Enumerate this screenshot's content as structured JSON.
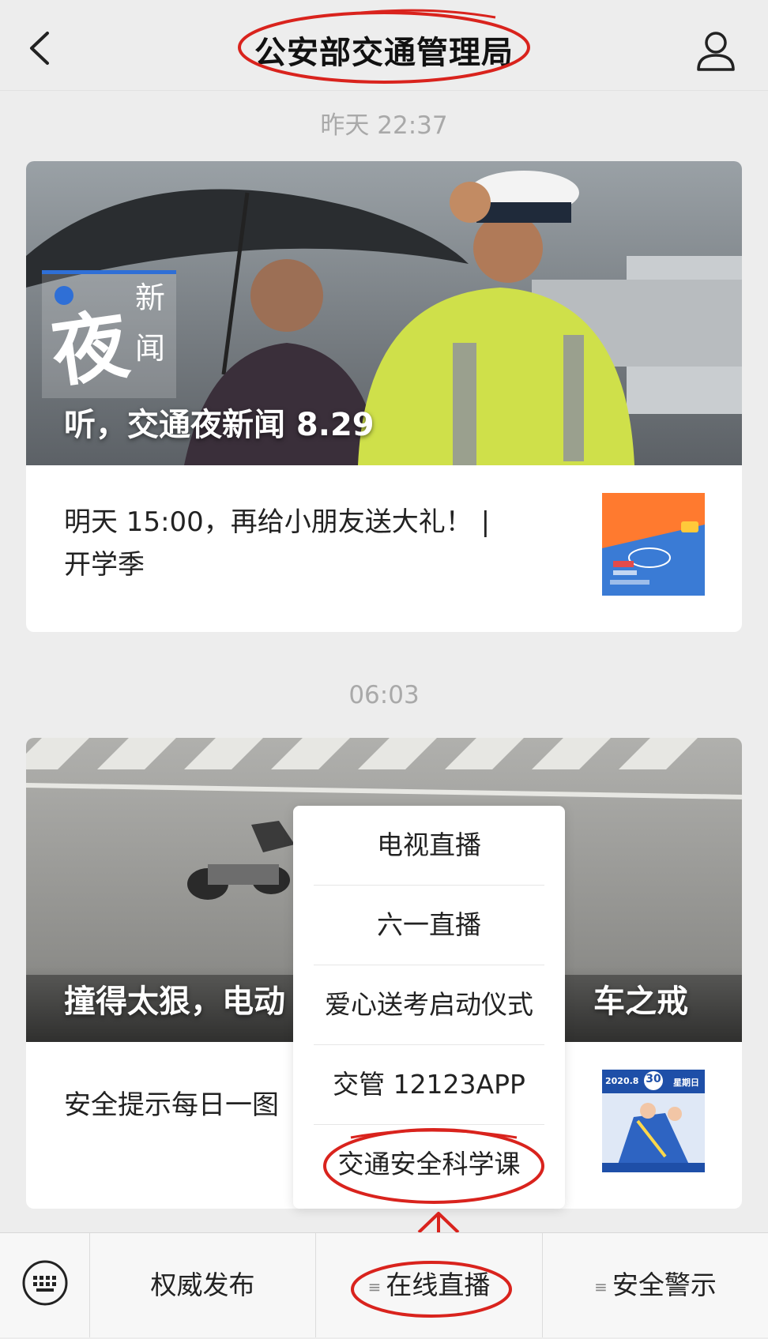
{
  "header": {
    "title": "公安部交通管理局"
  },
  "feed": {
    "time1": "昨天 22:37",
    "article1": {
      "logo_char": "夜",
      "logo_word1": "新",
      "logo_word2": "闻",
      "headline": "听，交通夜新闻 8.29",
      "sub_title": "明天 15:00，再给小朋友送大礼！ | 开学季"
    },
    "time2": "06:03",
    "article2": {
      "headline": "撞得太狠，电动",
      "headline_tail": "车之戒",
      "sub_title": "安全提示每日一图"
    },
    "thumb2": {
      "date": "2020.8",
      "day": "30",
      "weekday": "星期日"
    }
  },
  "popup_menu": {
    "items": [
      "电视直播",
      "六一直播",
      "爱心送考启动仪式",
      "交管 12123APP",
      "交通安全科学课"
    ]
  },
  "bottom_bar": {
    "tabs": [
      "权威发布",
      "在线直播",
      "安全警示"
    ]
  },
  "colors": {
    "annotation": "#d9231d",
    "background": "#ededed"
  }
}
